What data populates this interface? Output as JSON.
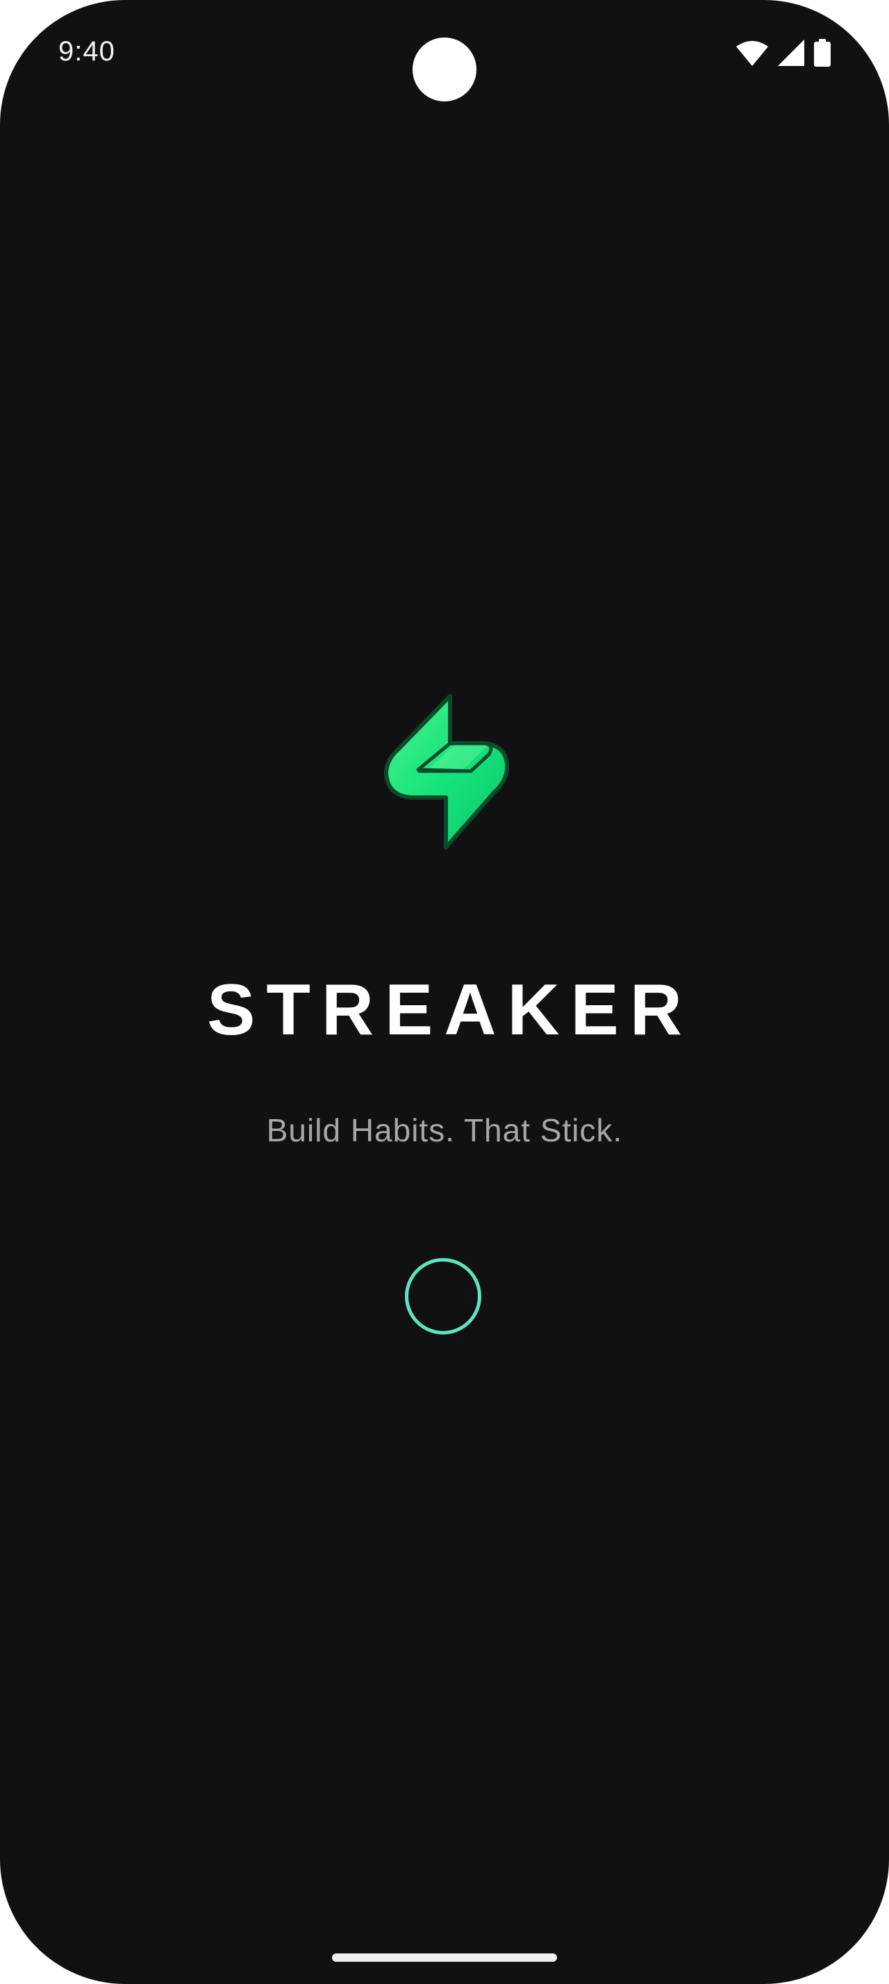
{
  "status_bar": {
    "time": "9:40",
    "icons": [
      "wifi-icon",
      "cellular-signal-icon",
      "battery-icon"
    ]
  },
  "splash": {
    "logo_icon": "lightning-bolt-icon",
    "app_name": "STREAKER",
    "tagline": "Build Habits. That Stick."
  },
  "colors": {
    "background": "#111111",
    "logo_green": "#1ee87a",
    "spinner": "#5ce6c0",
    "title": "#ffffff",
    "tagline": "#a7a7a7"
  }
}
